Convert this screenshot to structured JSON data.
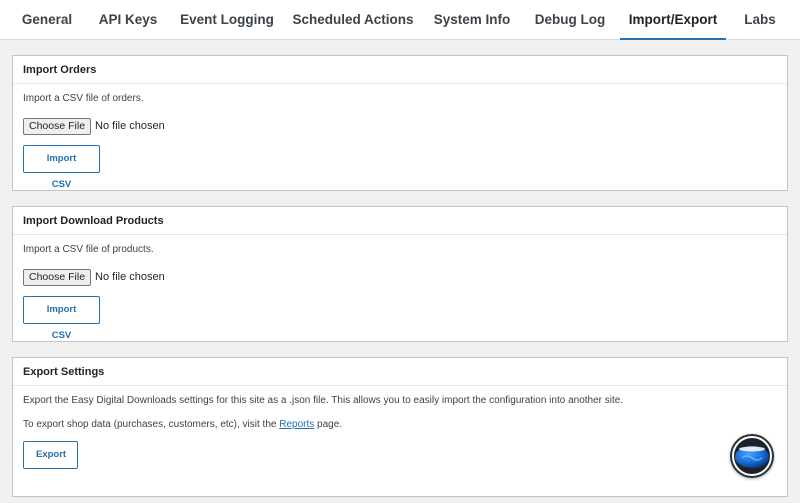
{
  "tabs": [
    {
      "label": "General"
    },
    {
      "label": "API Keys"
    },
    {
      "label": "Event Logging"
    },
    {
      "label": "Scheduled Actions"
    },
    {
      "label": "System Info"
    },
    {
      "label": "Debug Log"
    },
    {
      "label": "Import/Export",
      "active": true
    },
    {
      "label": "Labs"
    }
  ],
  "import_orders": {
    "title": "Import Orders",
    "description": "Import a CSV file of orders.",
    "choose_label": "Choose File",
    "file_status": "No file chosen",
    "button_label": "Import CSV"
  },
  "import_products": {
    "title": "Import Download Products",
    "description": "Import a CSV file of products.",
    "choose_label": "Choose File",
    "file_status": "No file chosen",
    "button_label": "Import CSV"
  },
  "export_settings": {
    "title": "Export Settings",
    "description": "Export the Easy Digital Downloads settings for this site as a .json file. This allows you to easily import the configuration into another site.",
    "reports_prefix": "To export shop data (purchases, customers, etc), visit the ",
    "reports_link": "Reports",
    "reports_suffix": " page.",
    "button_label": "Export"
  },
  "help": {
    "icon": "help-globe-icon"
  },
  "colors": {
    "accent": "#2271b1",
    "background": "#f0f0f1",
    "card_border": "#c3c4c7"
  }
}
